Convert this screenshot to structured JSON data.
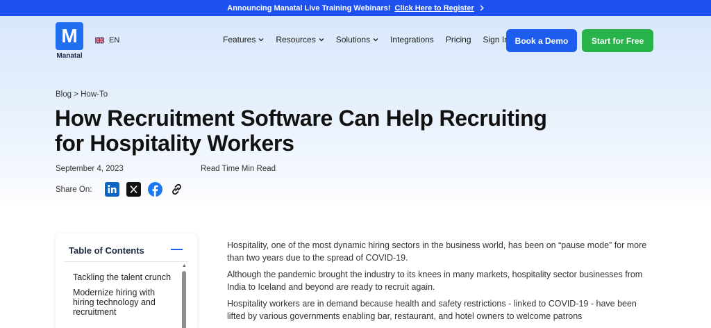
{
  "announcement": {
    "text": "Announcing Manatal Live Training Webinars!",
    "link": "Click Here to Register",
    "chevron_icon": "chevron-right-icon"
  },
  "header": {
    "logo_letter": "M",
    "logo_word": "Manatal",
    "language": "EN",
    "nav": [
      "Features",
      "Resources",
      "Solutions",
      "Integrations",
      "Pricing",
      "Sign In"
    ],
    "book_demo": "Book a Demo",
    "start_free": "Start for Free",
    "colors": {
      "brand_blue": "#1e5cf0",
      "cta_green": "#27b24a"
    }
  },
  "article": {
    "breadcrumb": "Blog > How-To",
    "title_line1": "How Recruitment Software Can Help Recruiting",
    "title_line2": "for Hospitality Workers",
    "date": "September 4, 2023",
    "read_time": "Read Time Min Read",
    "share_label": "Share On:",
    "share_icons": [
      "linkedin-icon",
      "x-icon",
      "facebook-icon",
      "link-icon"
    ]
  },
  "toc": {
    "title": "Table of Contents",
    "items": [
      "Tackling the talent crunch",
      "Modernize hiring with hiring technology and recruitment"
    ]
  },
  "body": {
    "p1": "Hospitality, one of the most dynamic hiring sectors in the business world, has been on “pause mode” for more than two years due to the spread of COVID-19.",
    "p2": "Although the pandemic brought the industry to its knees in many markets, hospitality sector businesses from India to Iceland and beyond are ready to recruit again.",
    "p3": "Hospitality workers are in demand because health and safety restrictions - linked to COVID-19 - have been lifted by various governments enabling bar, restaurant, and hotel owners to welcome patrons"
  }
}
